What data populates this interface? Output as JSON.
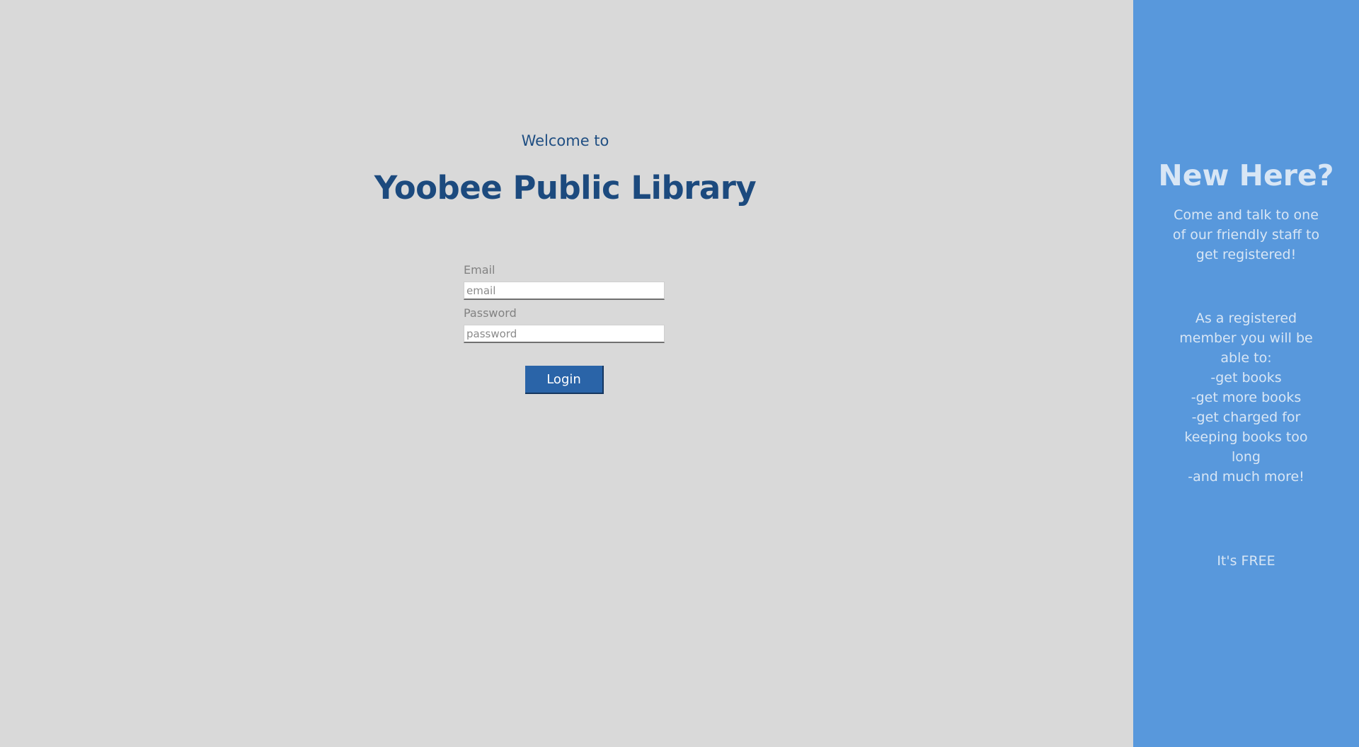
{
  "main": {
    "welcome_text": "Welcome to",
    "title": "Yoobee Public Library",
    "email": {
      "label": "Email",
      "placeholder": "email",
      "value": ""
    },
    "password": {
      "label": "Password",
      "placeholder": "password",
      "value": ""
    },
    "login_label": "Login"
  },
  "sidebar": {
    "heading": "New Here?",
    "intro": "Come and talk to one of our friendly staff to get registered!",
    "benefits": "As a registered member you will be able to:\n-get books\n-get more books\n-get charged for keeping books too long\n-and much more!",
    "free_text": "It's FREE"
  },
  "colors": {
    "page_background": "#d9d9d9",
    "sidebar_background": "#5898dc",
    "title_color": "#1c4a7e",
    "button_background": "#2a64a8",
    "sidebar_text": "#d8e6f5"
  }
}
